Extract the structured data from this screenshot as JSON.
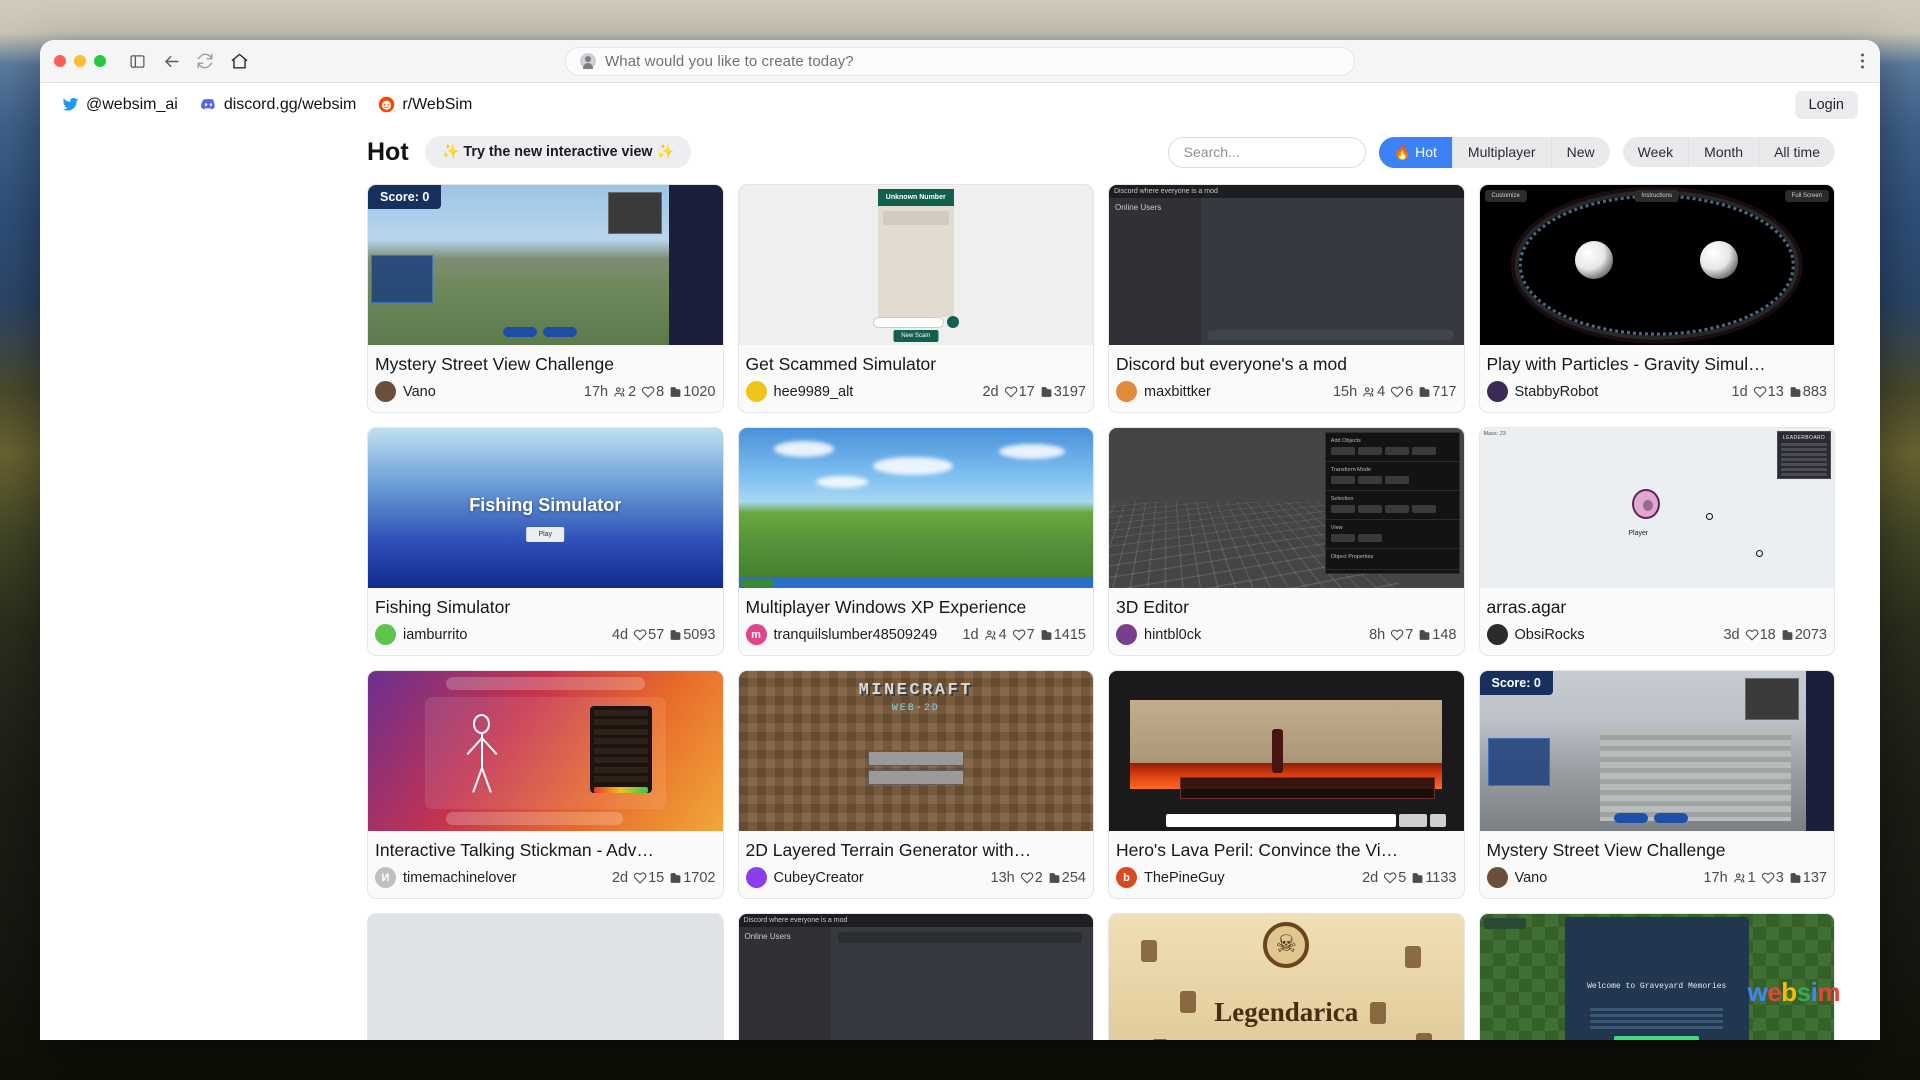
{
  "browser": {
    "omnibox_placeholder": "What would you like to create today?",
    "icons": [
      "traffic-lights",
      "sidebar-toggle-icon",
      "back-icon",
      "reload-icon",
      "home-icon",
      "kebab-menu-icon"
    ]
  },
  "topbar": {
    "links": [
      {
        "icon": "twitter-icon",
        "label": "@websim_ai"
      },
      {
        "icon": "discord-icon",
        "label": "discord.gg/websim"
      },
      {
        "icon": "reddit-icon",
        "label": "r/WebSim"
      }
    ],
    "login_label": "Login"
  },
  "header": {
    "title": "Hot",
    "cta_label": "✨ Try the new interactive view ✨",
    "search_placeholder": "Search...",
    "search_value": "",
    "sort_tabs": [
      {
        "label": "Hot",
        "icon": "flame-icon",
        "active": true
      },
      {
        "label": "Multiplayer",
        "active": false
      },
      {
        "label": "New",
        "active": false
      }
    ],
    "time_tabs": [
      {
        "label": "Week",
        "active": false
      },
      {
        "label": "Month",
        "active": false
      },
      {
        "label": "All time",
        "active": false
      }
    ]
  },
  "accent_color": "#3b82f6",
  "cards": [
    {
      "title": "Mystery Street View Challenge",
      "author": "Vano",
      "age": "17h",
      "plays": "2",
      "likes": "8",
      "views": "1020",
      "has_plays": true,
      "thumb": "street-view-1",
      "badge": "Score: 0",
      "avatar_color": "#6b4f3a",
      "avatar_letter": ""
    },
    {
      "title": "Get Scammed Simulator",
      "author": "hee9989_alt",
      "age": "2d",
      "plays": "",
      "likes": "17",
      "views": "3197",
      "has_plays": false,
      "thumb": "scam-phone",
      "avatar_color": "#f0c419",
      "avatar_letter": ""
    },
    {
      "title": "Discord but everyone's a mod",
      "author": "maxbittker",
      "age": "15h",
      "plays": "4",
      "likes": "6",
      "views": "717",
      "has_plays": true,
      "thumb": "discord-dark",
      "avatar_color": "#e08a3c",
      "avatar_letter": ""
    },
    {
      "title": "Play with Particles - Gravity Simul…",
      "author": "StabbyRobot",
      "age": "1d",
      "plays": "",
      "likes": "13",
      "views": "883",
      "has_plays": false,
      "thumb": "particles",
      "avatar_color": "#3b2a55",
      "avatar_letter": ""
    },
    {
      "title": "Fishing Simulator",
      "author": "iamburrito",
      "age": "4d",
      "plays": "",
      "likes": "57",
      "views": "5093",
      "has_plays": false,
      "thumb": "fishing",
      "avatar_color": "#5ec44a",
      "avatar_letter": ""
    },
    {
      "title": "Multiplayer Windows XP Experience",
      "author": "tranquilslumber48509249",
      "age": "1d",
      "plays": "4",
      "likes": "7",
      "views": "1415",
      "has_plays": true,
      "thumb": "windows-xp",
      "avatar_color": "#e0448c",
      "avatar_letter": "m"
    },
    {
      "title": "3D Editor",
      "author": "hintbl0ck",
      "age": "8h",
      "plays": "",
      "likes": "7",
      "views": "148",
      "has_plays": false,
      "thumb": "editor-3d",
      "avatar_color": "#7a3f8c",
      "avatar_letter": ""
    },
    {
      "title": "arras.agar",
      "author": "ObsiRocks",
      "age": "3d",
      "plays": "",
      "likes": "18",
      "views": "2073",
      "has_plays": false,
      "thumb": "agar",
      "avatar_color": "#2b2b2b",
      "avatar_letter": ""
    },
    {
      "title": "Interactive Talking Stickman - Adv…",
      "author": "timemachinelover",
      "age": "2d",
      "plays": "",
      "likes": "15",
      "views": "1702",
      "has_plays": false,
      "thumb": "stickman",
      "avatar_color": "#bfbfbf",
      "avatar_letter": "И"
    },
    {
      "title": "2D Layered Terrain Generator with…",
      "author": "CubeyCreator",
      "age": "13h",
      "plays": "",
      "likes": "2",
      "views": "254",
      "has_plays": false,
      "thumb": "minecraft",
      "avatar_color": "#8b3df0",
      "avatar_letter": ""
    },
    {
      "title": "Hero's Lava Peril: Convince the Vi…",
      "author": "ThePineGuy",
      "age": "2d",
      "plays": "",
      "likes": "5",
      "views": "1133",
      "has_plays": false,
      "thumb": "lava",
      "avatar_color": "#d94a1f",
      "avatar_letter": "b"
    },
    {
      "title": "Mystery Street View Challenge",
      "author": "Vano",
      "age": "17h",
      "plays": "1",
      "likes": "3",
      "views": "137",
      "has_plays": true,
      "thumb": "street-view-2",
      "badge": "Score: 0",
      "avatar_color": "#6b4f3a",
      "avatar_letter": ""
    },
    {
      "title": "",
      "author": "",
      "age": "",
      "plays": "",
      "likes": "",
      "views": "",
      "has_plays": false,
      "thumb": "blank"
    },
    {
      "title": "",
      "author": "",
      "age": "",
      "plays": "",
      "likes": "",
      "views": "",
      "has_plays": false,
      "thumb": "discord-dark-2"
    },
    {
      "title": "",
      "author": "",
      "age": "",
      "plays": "",
      "likes": "",
      "views": "",
      "has_plays": false,
      "thumb": "legendarica"
    },
    {
      "title": "",
      "author": "",
      "age": "",
      "plays": "",
      "likes": "",
      "views": "",
      "has_plays": false,
      "thumb": "graveyard"
    }
  ],
  "watermark": {
    "letters": [
      "w",
      "e",
      "b",
      "s",
      "i",
      "m"
    ]
  },
  "thumb_texts": {
    "street_badge": "Score: 0",
    "scam_header": "Unknown Number",
    "scam_button": "New Scam",
    "discord_title": "Discord where everyone is a mod",
    "discord_sidebar": "Online Users",
    "particles_tags": [
      "Customize",
      "Instructions",
      "Full Screen"
    ],
    "fishing_title": "Fishing Simulator",
    "fishing_button": "Play",
    "minecraft_logo": "MINECRAFT",
    "minecraft_sub": "WEB-2D",
    "agar_player": "Player",
    "agar_leaderboard": "LEADERBOARD",
    "agar_mass": "Mass: 23",
    "legendarica_title": "Legendarica",
    "graveyard_title": "Welcome to Graveyard Memories"
  }
}
